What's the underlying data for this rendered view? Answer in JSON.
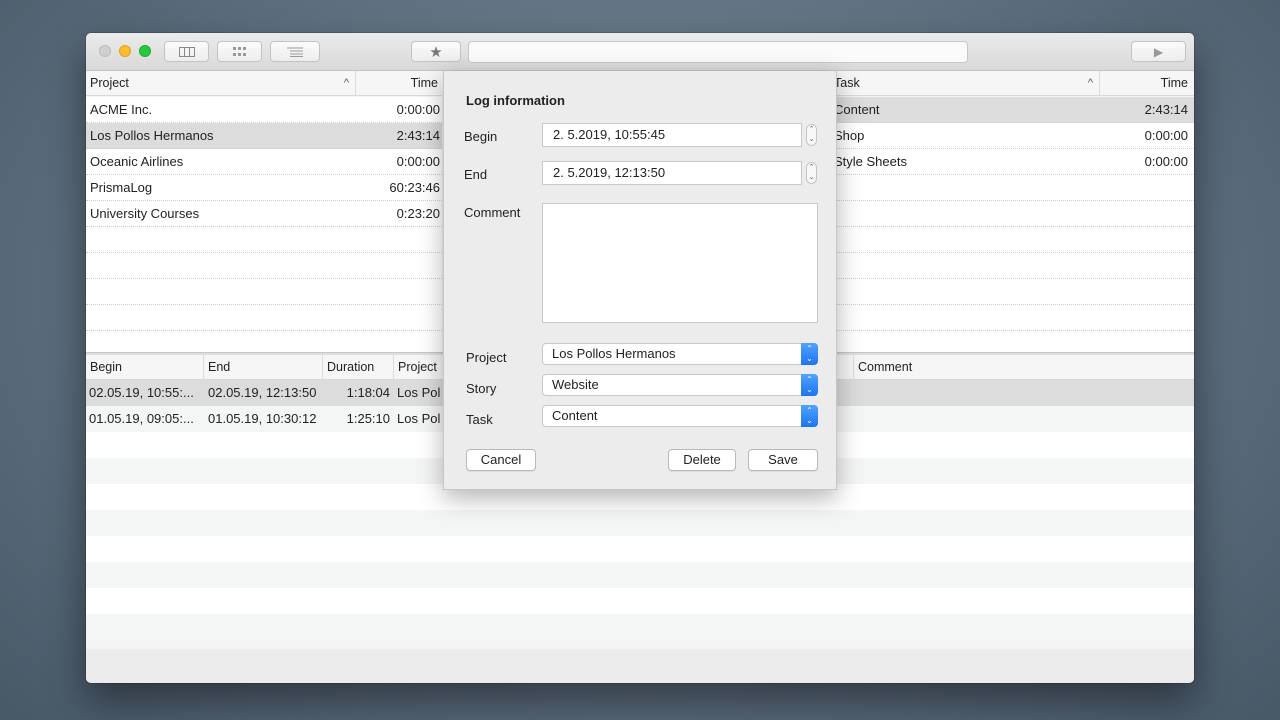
{
  "projects_table": {
    "headers": {
      "project": "Project",
      "time": "Time"
    },
    "rows": [
      {
        "name": "ACME Inc.",
        "time": "0:00:00"
      },
      {
        "name": "Los Pollos Hermanos",
        "time": "2:43:14"
      },
      {
        "name": "Oceanic Airlines",
        "time": "0:00:00"
      },
      {
        "name": "PrismaLog",
        "time": "60:23:46"
      },
      {
        "name": "University Courses",
        "time": "0:23:20"
      }
    ],
    "selected_index": 1
  },
  "tasks_table": {
    "headers": {
      "task": "Task",
      "time": "Time"
    },
    "rows": [
      {
        "name": "Content",
        "time": "2:43:14"
      },
      {
        "name": "Shop",
        "time": "0:00:00"
      },
      {
        "name": "Style Sheets",
        "time": "0:00:00"
      }
    ],
    "selected_index": 0
  },
  "logs_table": {
    "headers": {
      "begin": "Begin",
      "end": "End",
      "duration": "Duration",
      "project": "Project",
      "comment": "Comment"
    },
    "rows": [
      {
        "begin": "02.05.19, 10:55:...",
        "end": "02.05.19, 12:13:50",
        "duration": "1:18:04",
        "project": "Los Poll"
      },
      {
        "begin": "01.05.19, 09:05:...",
        "end": "01.05.19, 10:30:12",
        "duration": "1:25:10",
        "project": "Los Poll"
      }
    ]
  },
  "dialog": {
    "title": "Log information",
    "begin_label": "Begin",
    "begin_value": "2.  5.2019, 10:55:45",
    "end_label": "End",
    "end_value": "2.  5.2019, 12:13:50",
    "comment_label": "Comment",
    "comment_value": "",
    "project_label": "Project",
    "project_value": "Los Pollos Hermanos",
    "story_label": "Story",
    "story_value": "Website",
    "task_label": "Task",
    "task_value": "Content",
    "cancel_label": "Cancel",
    "delete_label": "Delete",
    "save_label": "Save"
  },
  "icons": {
    "star": "★",
    "play": "▶",
    "sort_up": "^",
    "stepper_up": "⌃",
    "stepper_down": "⌄"
  },
  "colors": {
    "selected_row": "#dcdcdc",
    "accent": "#1e74f0"
  }
}
